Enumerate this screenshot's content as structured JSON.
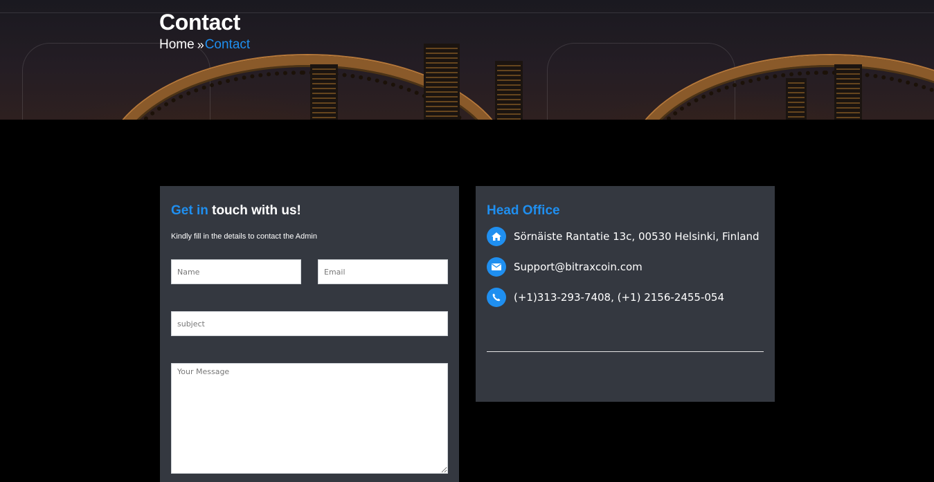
{
  "hero": {
    "title": "Contact",
    "breadcrumb": {
      "home": "Home",
      "separator": "»",
      "current": "Contact"
    }
  },
  "contact_form": {
    "title_accent": "Get in",
    "title_rest": "touch with us!",
    "subtitle": "Kindly fill in the details to contact the Admin",
    "name_placeholder": "Name",
    "email_placeholder": "Email",
    "subject_placeholder": "subject",
    "message_placeholder": "Your Message"
  },
  "head_office": {
    "title": "Head Office",
    "address": "Sörnäiste Rantatie 13c, 00530 Helsinki, Finland",
    "email": "Support@bitraxcoin.com",
    "phone": "(+1)313-293-7408, (+1) 2156-2455-054",
    "icons": [
      "home-icon",
      "envelope-icon",
      "phone-icon"
    ]
  },
  "colors": {
    "accent": "#1f8ff0",
    "card_bg": "#343840",
    "page_bg": "#000000"
  }
}
